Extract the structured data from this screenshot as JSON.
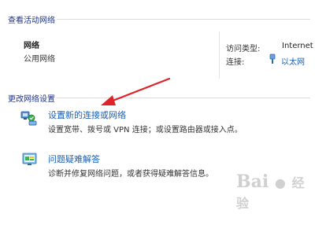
{
  "active_networks": {
    "section_title": "查看活动网络",
    "network_name": "网络",
    "network_type": "公用网络",
    "access_type_label": "访问类型:",
    "access_type_value": "Internet",
    "connections_label": "连接:",
    "connection_value": "以太网"
  },
  "change_settings": {
    "section_title": "更改网络设置",
    "items": [
      {
        "link": "设置新的连接或网络",
        "description": "设置宽带、拨号或 VPN 连接；或设置路由器或接入点。",
        "icon": "network-setup-icon"
      },
      {
        "link": "问题疑难解答",
        "description": "诊断并修复网络问题，或者获得疑难解答信息。",
        "icon": "troubleshoot-icon"
      }
    ]
  },
  "annotation": {
    "arrow_color": "#e0222a"
  },
  "watermark": {
    "text": "Bai",
    "text2": "经验"
  }
}
